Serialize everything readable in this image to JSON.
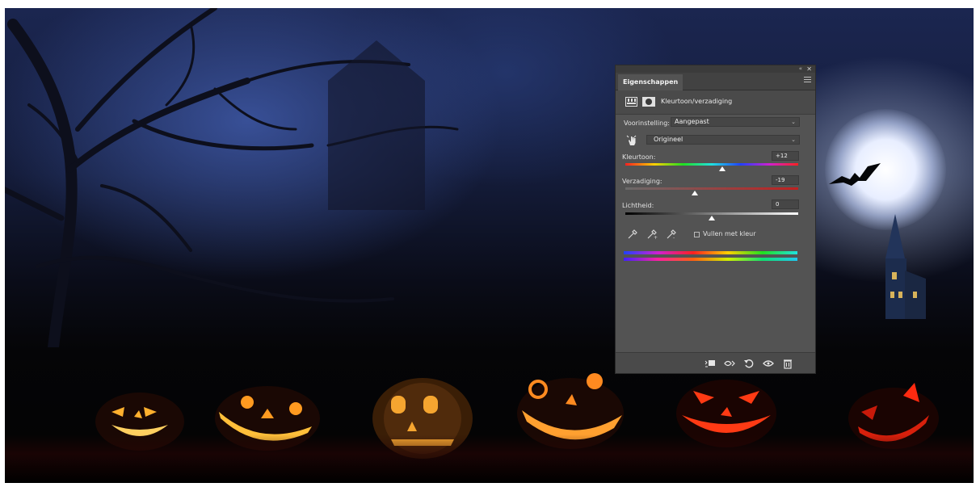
{
  "panel": {
    "tab_label": "Eigenschappen",
    "collapse_glyph": "«",
    "close_glyph": "✕",
    "adjustment_title": "Kleurtoon/verzadiging",
    "preset_label": "Voorinstelling:",
    "preset_value": "Aangepast",
    "channel_value": "Origineel",
    "hue": {
      "label": "Kleurtoon:",
      "value": "+12",
      "thumb_fraction": 0.56
    },
    "saturation": {
      "label": "Verzadiging:",
      "value": "-19",
      "thumb_fraction": 0.4
    },
    "lightness": {
      "label": "Lichtheid:",
      "value": "0",
      "thumb_fraction": 0.5
    },
    "colorize_label": "Vullen met kleur",
    "colorize_checked": false
  },
  "icons": {
    "menu": "panel-menu-icon",
    "adjustment": "hue-saturation-adjustment-icon",
    "mask": "layer-mask-icon",
    "targeted_adjustment": "targeted-adjustment-hand-icon",
    "eyedroppers": [
      "eyedropper-icon",
      "eyedropper-add-icon",
      "eyedropper-subtract-icon"
    ],
    "bottom": [
      "clip-to-layer-icon",
      "view-previous-state-icon",
      "reset-icon",
      "toggle-visibility-icon",
      "delete-icon"
    ]
  },
  "colors": {
    "panel_bg": "#535353",
    "accent_text": "#e8e8e8"
  }
}
